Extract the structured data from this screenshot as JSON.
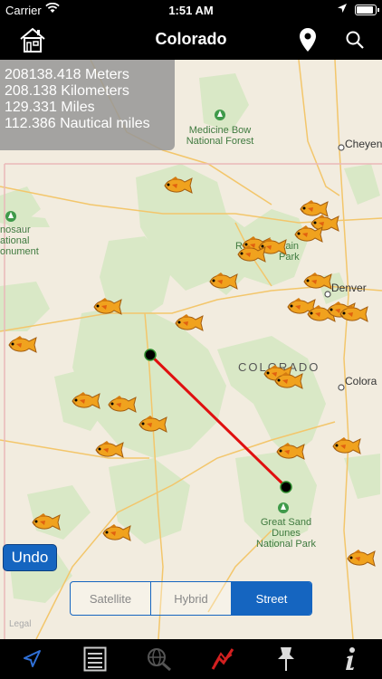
{
  "status": {
    "carrier": "Carrier",
    "time": "1:51 AM",
    "battery_level": 0.9
  },
  "nav": {
    "title": "Colorado"
  },
  "measurements": {
    "meters": "208138.418 Meters",
    "kilometers": "208.138 Kilometers",
    "miles": "129.331 Miles",
    "nautical": "112.386 Nautical miles"
  },
  "map": {
    "parks": {
      "medicine_bow_1": "Medicine Bow",
      "medicine_bow_2": "National Forest",
      "dinosaur_1": "nosaur",
      "dinosaur_2": "ational",
      "dinosaur_3": "onument",
      "rocky_1": "R",
      "rocky_2": "ountain",
      "rocky_3": "Park",
      "great_sand_1": "Great Sand",
      "great_sand_2": "Dunes",
      "great_sand_3": "National Park"
    },
    "cities": {
      "cheyenne": "Cheyenn",
      "denver": "Denver",
      "colorado_springs": "Colora"
    },
    "state": "COLORADO",
    "legal": "Legal",
    "colors": {
      "land": "#f2ecdf",
      "forest": "#d9e8c6",
      "road": "#f3c66b",
      "line": "#e01010",
      "border": "#e9b8b8"
    }
  },
  "undo_label": "Undo",
  "map_types": {
    "satellite": "Satellite",
    "hybrid": "Hybrid",
    "street": "Street",
    "selected": "Street"
  },
  "tabs": [
    "navigate-icon",
    "list-icon",
    "globe-search-icon",
    "measure-icon",
    "pin-icon",
    "info-icon"
  ]
}
